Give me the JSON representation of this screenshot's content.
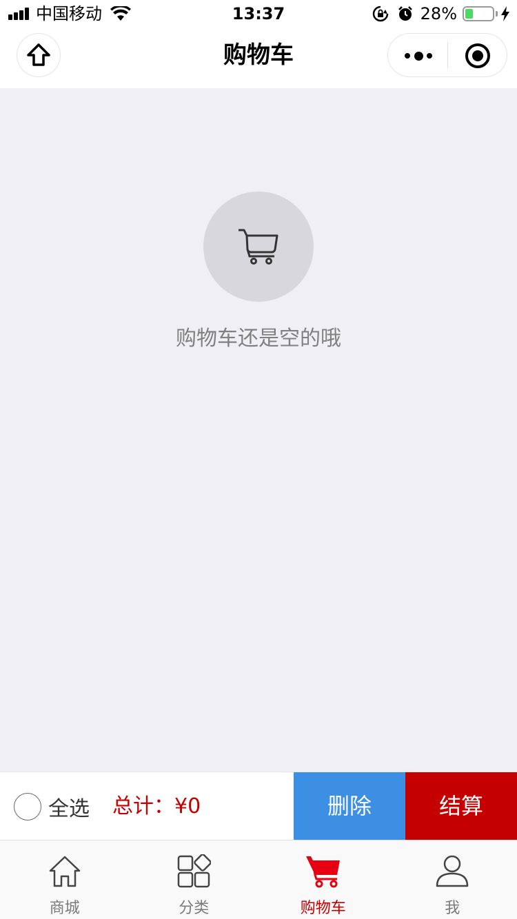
{
  "status_bar": {
    "carrier": "中国移动",
    "time": "13:37",
    "battery_percent": "28%",
    "battery_level": 0.28
  },
  "nav": {
    "title": "购物车"
  },
  "empty_state": {
    "icon": "cart-icon",
    "message": "购物车还是空的哦"
  },
  "action_bar": {
    "select_all_label": "全选",
    "total_label": "总计：",
    "total_value": "¥0",
    "delete_label": "删除",
    "checkout_label": "结算"
  },
  "tabs": [
    {
      "label": "商城",
      "icon": "home-icon",
      "active": false
    },
    {
      "label": "分类",
      "icon": "category-icon",
      "active": false
    },
    {
      "label": "购物车",
      "icon": "cart-icon",
      "active": true
    },
    {
      "label": "我",
      "icon": "user-icon",
      "active": false
    }
  ],
  "colors": {
    "accent_red": "#c40000",
    "delete_blue": "#3d8fe3",
    "background": "#efeff4"
  }
}
